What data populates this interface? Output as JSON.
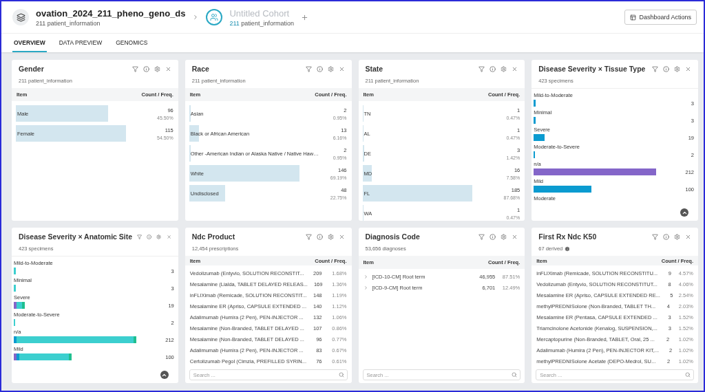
{
  "header": {
    "dataset": {
      "name": "ovation_2024_211_pheno_geno_ds",
      "subtitle": "211 patient_information"
    },
    "cohort": {
      "name": "Untitled Cohort",
      "count": "211",
      "subtitle": "patient_information"
    },
    "actions_button": "Dashboard Actions"
  },
  "tabs": [
    {
      "label": "OVERVIEW",
      "selected": true
    },
    {
      "label": "DATA PREVIEW",
      "selected": false
    },
    {
      "label": "GENOMICS",
      "selected": false
    }
  ],
  "cards": [
    {
      "kind": "bars",
      "title": "Gender",
      "subtitle": "211 patient_information",
      "columns": [
        "Item",
        "Count / Freq."
      ],
      "rows": [
        {
          "label": "Male",
          "count": "96",
          "freq": "45.50%"
        },
        {
          "label": "Female",
          "count": "115",
          "freq": "54.50%"
        }
      ]
    },
    {
      "kind": "bars",
      "title": "Race",
      "subtitle": "211 patient_information",
      "columns": [
        "Item",
        "Count / Freq."
      ],
      "rows": [
        {
          "label": "Asian",
          "count": "2",
          "freq": "0.95%"
        },
        {
          "label": "Black or African American",
          "count": "13",
          "freq": "6.16%"
        },
        {
          "label": "Other -American Indian or Alaska Native / Native Haw…",
          "count": "2",
          "freq": "0.95%"
        },
        {
          "label": "White",
          "count": "146",
          "freq": "69.19%"
        },
        {
          "label": "Undisclosed",
          "count": "48",
          "freq": "22.75%"
        }
      ]
    },
    {
      "kind": "bars",
      "title": "State",
      "subtitle": "211 patient_information",
      "columns": [
        "Item",
        "Count / Freq."
      ],
      "rows": [
        {
          "label": "TN",
          "count": "1",
          "freq": "0.47%"
        },
        {
          "label": "AL",
          "count": "1",
          "freq": "0.47%"
        },
        {
          "label": "DE",
          "count": "3",
          "freq": "1.42%"
        },
        {
          "label": "MD",
          "count": "16",
          "freq": "7.58%"
        },
        {
          "label": "FL",
          "count": "185",
          "freq": "87.68%"
        },
        {
          "label": "WA",
          "count": "1",
          "freq": "0.47%"
        }
      ]
    },
    {
      "kind": "stacked",
      "title": "Disease Severity × Tissue Type",
      "subtitle": "423 specimens",
      "rows": [
        {
          "label": "Mild-to-Moderate",
          "count": "3",
          "segments": [
            {
              "kind": "main",
              "color": "#0b9bd0"
            }
          ]
        },
        {
          "label": "Minimal",
          "count": "3",
          "segments": [
            {
              "kind": "main",
              "color": "#0b9bd0"
            }
          ]
        },
        {
          "label": "Severe",
          "count": "19",
          "segments": [
            {
              "kind": "main",
              "color": "#0b9bd0"
            }
          ]
        },
        {
          "label": "Moderate-to-Severe",
          "count": "2",
          "segments": [
            {
              "kind": "main",
              "color": "#0b9bd0"
            }
          ]
        },
        {
          "label": "n/a",
          "count": "212",
          "segments": [
            {
              "kind": "main",
              "color": "#8466c9"
            }
          ]
        },
        {
          "label": "Mild",
          "count": "100",
          "segments": [
            {
              "kind": "main",
              "color": "#0b9bd0"
            }
          ]
        },
        {
          "label": "Moderate"
        }
      ]
    },
    {
      "kind": "stacked",
      "title": "Disease Severity × Anatomic Site",
      "subtitle": "423 specimens",
      "rows": [
        {
          "label": "Mild-to-Moderate",
          "count": "3",
          "segments": [
            {
              "kind": "main",
              "color": "#3ccfcf"
            }
          ]
        },
        {
          "label": "Minimal",
          "count": "3",
          "segments": [
            {
              "kind": "main",
              "color": "#3ccfcf"
            }
          ]
        },
        {
          "label": "Severe",
          "count": "19",
          "segments": [
            {
              "kind": "edge",
              "color": "#8466c9"
            },
            {
              "kind": "main",
              "color": "#3ccfcf"
            },
            {
              "kind": "edge",
              "color": "#1fbf8f"
            }
          ]
        },
        {
          "label": "Moderate-to-Severe",
          "count": "2",
          "segments": [
            {
              "kind": "main",
              "color": "#3ccfcf"
            }
          ]
        },
        {
          "label": "n/a",
          "count": "212",
          "segments": [
            {
              "kind": "edge",
              "color": "#0b9bd0"
            },
            {
              "kind": "main",
              "color": "#3ccfcf"
            },
            {
              "kind": "edge",
              "color": "#1fbf8f"
            }
          ]
        },
        {
          "label": "Mild",
          "count": "100",
          "segments": [
            {
              "kind": "edge",
              "color": "#8466c9"
            },
            {
              "kind": "edge",
              "color": "#0b9bd0"
            },
            {
              "kind": "main",
              "color": "#3ccfcf"
            },
            {
              "kind": "edge",
              "color": "#1fbf8f"
            }
          ]
        }
      ]
    },
    {
      "kind": "table",
      "title": "Ndc Product",
      "subtitle": "12,454 prescriptions",
      "columns": [
        "Item",
        "Count / Freq."
      ],
      "search": {
        "placeholder": "Search ..."
      },
      "rows": [
        {
          "label": "Vedolizumab (Entyvio, SOLUTION RECONSTIT...",
          "count": "209",
          "freq": "1.68%"
        },
        {
          "label": "Mesalamine (Lialda, TABLET DELAYED RELEAS...",
          "count": "169",
          "freq": "1.36%"
        },
        {
          "label": "inFLIXimab (Remicade, SOLUTION RECONSTIT...",
          "count": "148",
          "freq": "1.19%"
        },
        {
          "label": "Mesalamine ER (Apriso, CAPSULE EXTENDED ...",
          "count": "140",
          "freq": "1.12%"
        },
        {
          "label": "Adalimumab (Humira (2 Pen), PEN-INJECTOR ...",
          "count": "132",
          "freq": "1.06%"
        },
        {
          "label": "Mesalamine (Non-Branded, TABLET DELAYED ...",
          "count": "107",
          "freq": "0.86%"
        },
        {
          "label": "Mesalamine (Non-Branded, TABLET DELAYED ...",
          "count": "96",
          "freq": "0.77%"
        },
        {
          "label": "Adalimumab (Humira (2 Pen), PEN-INJECTOR ...",
          "count": "83",
          "freq": "0.67%"
        },
        {
          "label": "Certolizumab Pegol (Cimzia, PREFILLED SYRIN...",
          "count": "76",
          "freq": "0.61%"
        }
      ]
    },
    {
      "kind": "tree",
      "title": "Diagnosis Code",
      "subtitle": "53,656 diagnoses",
      "columns": [
        "Item",
        "Count / Freq."
      ],
      "search": {
        "placeholder": "Search ..."
      },
      "rows": [
        {
          "label": "[ICD-10-CM] Root term",
          "count": "46,955",
          "freq": "87.51%",
          "expanded": false
        },
        {
          "label": "[ICD-9-CM] Root term",
          "count": "6,701",
          "freq": "12.49%",
          "expanded": false
        }
      ]
    },
    {
      "kind": "table",
      "title": "First Rx Ndc K50",
      "subtitle": "67 derived",
      "subtitle_info": true,
      "columns": [
        "Item",
        "Count / Freq."
      ],
      "search": {
        "placeholder": "Search ..."
      },
      "rows": [
        {
          "label": "inFLIXimab (Remicade, SOLUTION RECONSTITU...",
          "count": "9",
          "freq": "4.57%"
        },
        {
          "label": "Vedolizumab (Entyvio, SOLUTION RECONSTITUT...",
          "count": "8",
          "freq": "4.06%"
        },
        {
          "label": "Mesalamine ER (Apriso, CAPSULE EXTENDED RE...",
          "count": "5",
          "freq": "2.54%"
        },
        {
          "label": "methylPREDNISolone (Non-Branded, TABLET TH...",
          "count": "4",
          "freq": "2.03%"
        },
        {
          "label": "Mesalamine ER (Pentasa, CAPSULE EXTENDED ...",
          "count": "3",
          "freq": "1.52%"
        },
        {
          "label": "Triamcinolone Acetonide (Kenalog, SUSPENSION,...",
          "count": "3",
          "freq": "1.52%"
        },
        {
          "label": "Mercaptopurine (Non-Branded, TABLET, Oral, 25 ...",
          "count": "2",
          "freq": "1.02%"
        },
        {
          "label": "Adalimumab (Humira (2 Pen), PEN-INJECTOR KIT,...",
          "count": "2",
          "freq": "1.02%"
        },
        {
          "label": "methylPREDNISolone Acetate (DEPO-Medrol, SU...",
          "count": "2",
          "freq": "1.02%"
        }
      ]
    }
  ]
}
